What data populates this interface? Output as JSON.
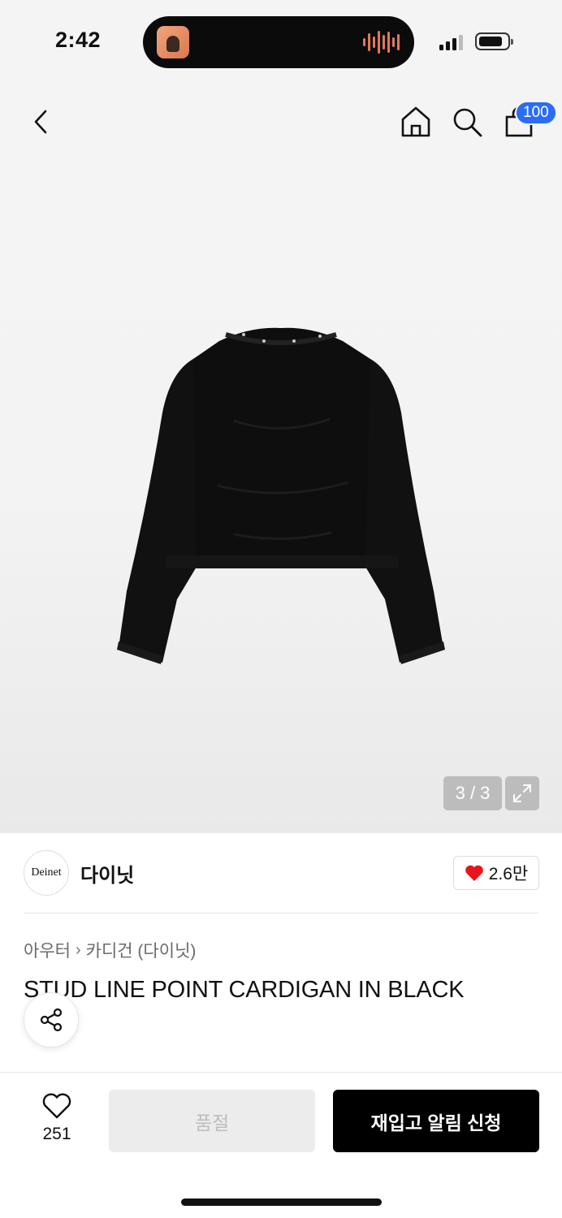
{
  "status_bar": {
    "time": "2:42"
  },
  "nav": {
    "cart_count": "100"
  },
  "gallery": {
    "counter": "3 / 3"
  },
  "brand": {
    "logo_text": "Deinet",
    "name": "다이닛",
    "likes": "2.6만"
  },
  "product": {
    "breadcrumb": [
      "아우터",
      "카디건 (다이닛)"
    ],
    "title": "STUD LINE POINT CARDIGAN IN BLACK"
  },
  "bottom_bar": {
    "wish_count": "251",
    "soldout_label": "품절",
    "restock_label": "재입고 알림 신청"
  },
  "colors": {
    "accent": "#2a6df4",
    "like_red": "#e8161c",
    "primary_button": "#000000"
  },
  "icons": [
    "back-icon",
    "home-icon",
    "search-icon",
    "cart-icon",
    "expand-icon",
    "heart-icon",
    "share-icon"
  ]
}
